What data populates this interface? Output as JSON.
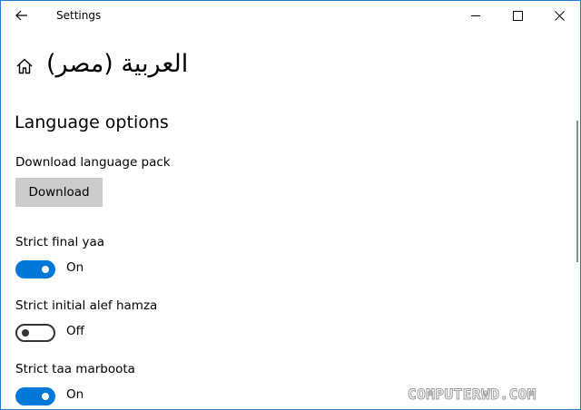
{
  "titlebar": {
    "title": "Settings",
    "back_icon": "back-arrow-icon",
    "minimize_icon": "minimize-icon",
    "maximize_icon": "maximize-icon",
    "close_icon": "close-icon"
  },
  "header": {
    "home_icon": "home-icon",
    "title": "العربية (مصر)"
  },
  "section": {
    "title": "Language options"
  },
  "download": {
    "label": "Download language pack",
    "button_label": "Download"
  },
  "toggles": [
    {
      "label": "Strict final yaa",
      "state": "On",
      "on": true
    },
    {
      "label": "Strict initial alef hamza",
      "state": "Off",
      "on": false
    },
    {
      "label": "Strict taa marboota",
      "state": "On",
      "on": true
    }
  ],
  "watermark": "COMPUTERWD.COM",
  "colors": {
    "accent": "#0078d7",
    "window_border": "#1e7bd6",
    "button_bg": "#cccccc"
  }
}
